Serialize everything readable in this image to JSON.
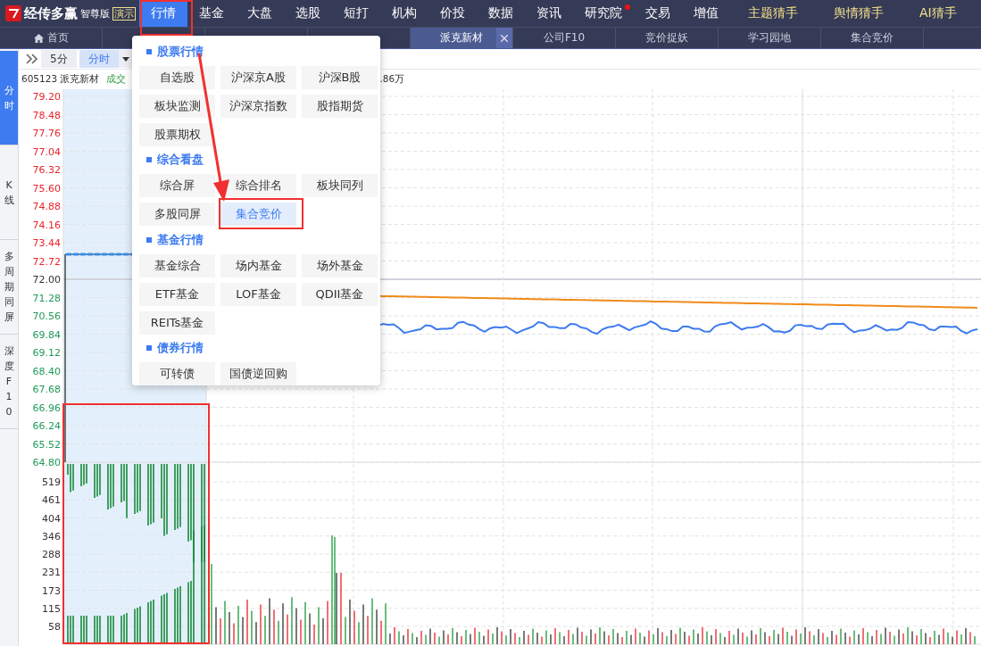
{
  "app": {
    "brand": "经传多赢",
    "edition": "智尊版",
    "mode_badge": "演示"
  },
  "menu_bar": [
    {
      "label": "行情",
      "selected": true,
      "kind": "normal",
      "dot": false
    },
    {
      "label": "基金",
      "selected": false,
      "kind": "normal",
      "dot": false
    },
    {
      "label": "大盘",
      "selected": false,
      "kind": "normal",
      "dot": false
    },
    {
      "label": "选股",
      "selected": false,
      "kind": "normal",
      "dot": false
    },
    {
      "label": "短打",
      "selected": false,
      "kind": "normal",
      "dot": false
    },
    {
      "label": "机构",
      "selected": false,
      "kind": "normal",
      "dot": false
    },
    {
      "label": "价投",
      "selected": false,
      "kind": "normal",
      "dot": false
    },
    {
      "label": "数据",
      "selected": false,
      "kind": "normal",
      "dot": false
    },
    {
      "label": "资讯",
      "selected": false,
      "kind": "normal",
      "dot": false
    },
    {
      "label": "研究院",
      "selected": false,
      "kind": "normal",
      "dot": true
    },
    {
      "label": "交易",
      "selected": false,
      "kind": "normal",
      "dot": false
    },
    {
      "label": "增值",
      "selected": false,
      "kind": "normal",
      "dot": false
    },
    {
      "label": "主题猜手",
      "selected": false,
      "kind": "accent",
      "dot": false
    },
    {
      "label": "舆情猜手",
      "selected": false,
      "kind": "accent",
      "dot": false
    },
    {
      "label": "AI猜手",
      "selected": false,
      "kind": "accent",
      "dot": false
    }
  ],
  "tabs": [
    {
      "label": "首页",
      "kind": "home",
      "selected": false,
      "closable": false
    },
    {
      "label": "派克新材",
      "kind": "page",
      "selected": true,
      "closable": true
    },
    {
      "label": "公司F10",
      "kind": "page",
      "selected": false,
      "closable": false
    },
    {
      "label": "竞价捉妖",
      "kind": "page",
      "selected": false,
      "closable": false
    },
    {
      "label": "学习园地",
      "kind": "page",
      "selected": false,
      "closable": false
    },
    {
      "label": "集合竞价",
      "kind": "page",
      "selected": false,
      "closable": false
    }
  ],
  "side_tabs": [
    {
      "label": "分时",
      "selected": true
    },
    {
      "label": "K线",
      "selected": false
    },
    {
      "label": "多周期同屏",
      "selected": false
    },
    {
      "label": "深度F10",
      "selected": false
    }
  ],
  "toolbar": {
    "periods": [
      {
        "label": "5分",
        "selected": false,
        "dropdown": false
      },
      {
        "label": "分时",
        "selected": true,
        "dropdown": true
      }
    ]
  },
  "quote_line": {
    "stock": "605123 派克新材",
    "volume_label": "成交",
    "volume_tail": ".86万"
  },
  "price_axis": [
    {
      "label": "79.20",
      "color": "#e8242a"
    },
    {
      "label": "78.48",
      "color": "#e8242a"
    },
    {
      "label": "77.76",
      "color": "#e8242a"
    },
    {
      "label": "77.04",
      "color": "#e8242a"
    },
    {
      "label": "76.32",
      "color": "#e8242a"
    },
    {
      "label": "75.60",
      "color": "#e8242a"
    },
    {
      "label": "74.88",
      "color": "#e8242a"
    },
    {
      "label": "74.16",
      "color": "#e8242a"
    },
    {
      "label": "73.44",
      "color": "#e8242a"
    },
    {
      "label": "72.72",
      "color": "#e8242a"
    },
    {
      "label": "72.00",
      "color": "#333333"
    },
    {
      "label": "71.28",
      "color": "#1f9a5a"
    },
    {
      "label": "70.56",
      "color": "#1f9a5a"
    },
    {
      "label": "69.84",
      "color": "#1f9a5a"
    },
    {
      "label": "69.12",
      "color": "#1f9a5a"
    },
    {
      "label": "68.40",
      "color": "#1f9a5a"
    },
    {
      "label": "67.68",
      "color": "#1f9a5a"
    },
    {
      "label": "66.96",
      "color": "#1f9a5a"
    },
    {
      "label": "66.24",
      "color": "#1f9a5a"
    },
    {
      "label": "65.52",
      "color": "#1f9a5a"
    },
    {
      "label": "64.80",
      "color": "#1f9a5a"
    }
  ],
  "volume_axis": [
    "519",
    "461",
    "404",
    "346",
    "288",
    "231",
    "173",
    "115",
    "58"
  ],
  "dropdown": {
    "sections": [
      {
        "title": "股票行情",
        "items": [
          {
            "label": "自选股",
            "selected": false
          },
          {
            "label": "沪深京A股",
            "selected": false
          },
          {
            "label": "沪深B股",
            "selected": false
          },
          {
            "label": "板块监测",
            "selected": false
          },
          {
            "label": "沪深京指数",
            "selected": false
          },
          {
            "label": "股指期货",
            "selected": false
          },
          {
            "label": "股票期权",
            "selected": false
          }
        ]
      },
      {
        "title": "综合看盘",
        "items": [
          {
            "label": "综合屏",
            "selected": false
          },
          {
            "label": "综合排名",
            "selected": false
          },
          {
            "label": "板块同列",
            "selected": false
          },
          {
            "label": "多股同屏",
            "selected": false
          },
          {
            "label": "集合竞价",
            "selected": true
          }
        ]
      },
      {
        "title": "基金行情",
        "items": [
          {
            "label": "基金综合",
            "selected": false
          },
          {
            "label": "场内基金",
            "selected": false
          },
          {
            "label": "场外基金",
            "selected": false
          },
          {
            "label": "ETF基金",
            "selected": false
          },
          {
            "label": "LOF基金",
            "selected": false
          },
          {
            "label": "QDII基金",
            "selected": false
          },
          {
            "label": "REITs基金",
            "selected": false
          }
        ]
      },
      {
        "title": "债券行情",
        "items": [
          {
            "label": "可转债",
            "selected": false
          },
          {
            "label": "国债逆回购",
            "selected": false
          }
        ]
      }
    ]
  }
}
